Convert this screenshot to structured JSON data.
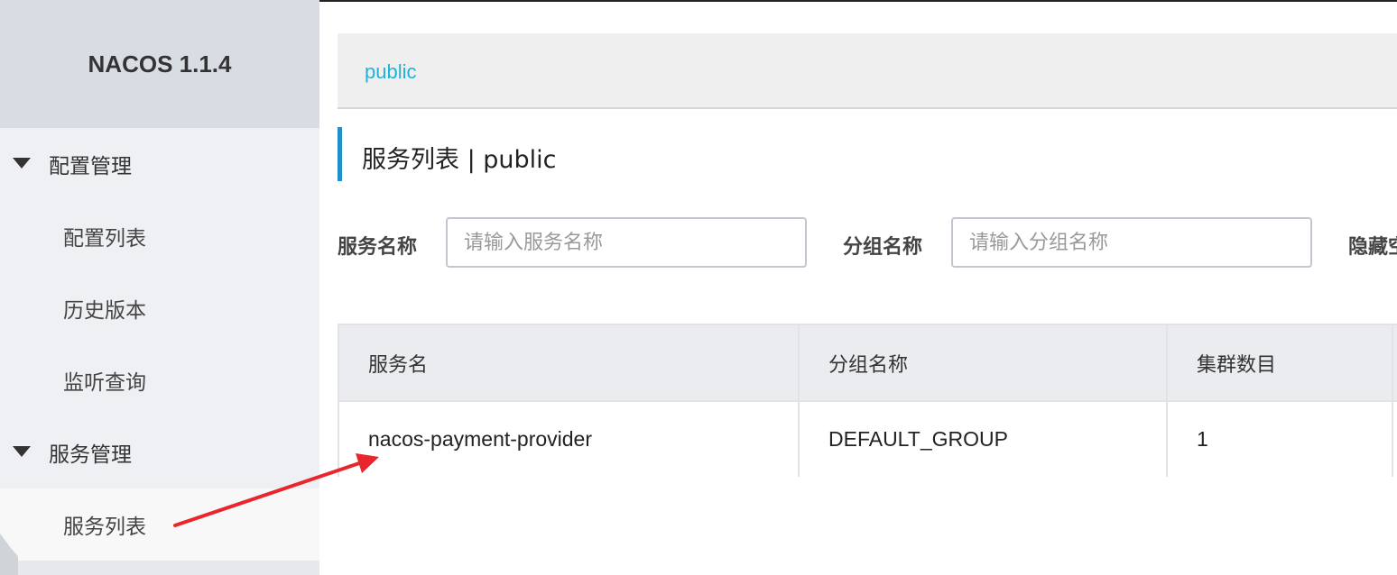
{
  "app": {
    "brand": "NACOS 1.1.4"
  },
  "sidebar": {
    "groups": [
      {
        "label": "配置管理",
        "items": [
          {
            "label": "配置列表"
          },
          {
            "label": "历史版本"
          },
          {
            "label": "监听查询"
          }
        ]
      },
      {
        "label": "服务管理",
        "items": [
          {
            "label": "服务列表"
          }
        ]
      }
    ]
  },
  "namespace_bar": {
    "current": "public"
  },
  "page": {
    "title": "服务列表  |  public"
  },
  "filters": {
    "service_name_label": "服务名称",
    "service_name_placeholder": "请输入服务名称",
    "group_name_label": "分组名称",
    "group_name_placeholder": "请输入分组名称",
    "hide_label_partial": "隐藏空"
  },
  "table": {
    "columns": [
      "服务名",
      "分组名称",
      "集群数目"
    ],
    "rows": [
      [
        "nacos-payment-provider",
        "DEFAULT_GROUP",
        "1"
      ]
    ]
  },
  "colors": {
    "accent": "#1fb3d6",
    "title_bar": "#1f90c8",
    "annotation_arrow": "#e8262b"
  }
}
